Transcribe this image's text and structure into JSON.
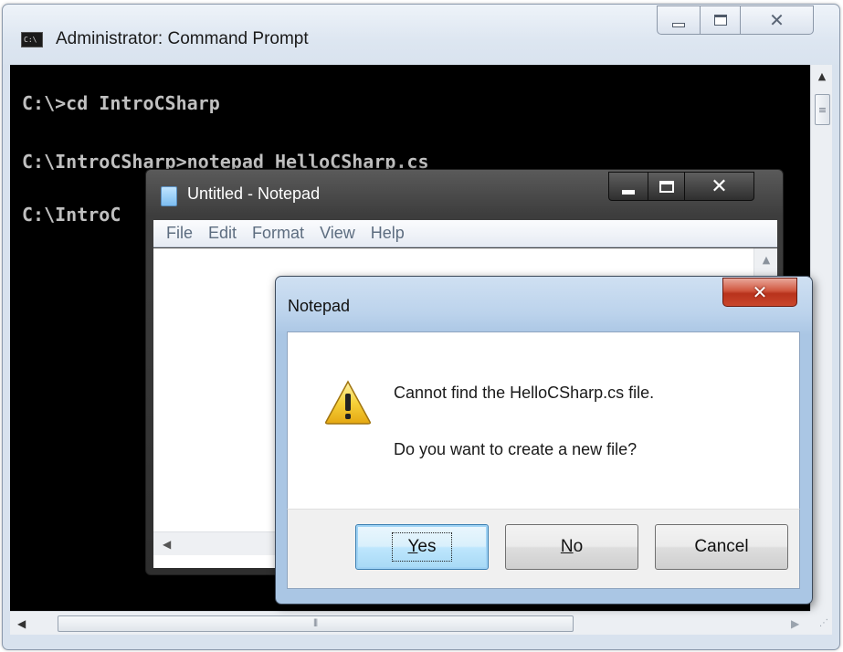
{
  "cmd_window": {
    "title": "Administrator: Command Prompt",
    "icon_text": "C:\\",
    "console_lines": [
      "C:\\>cd IntroCSharp",
      "C:\\IntroCSharp>notepad HelloCSharp.cs",
      "C:\\IntroC"
    ]
  },
  "notepad": {
    "title": "Untitled - Notepad",
    "menu": [
      "File",
      "Edit",
      "Format",
      "View",
      "Help"
    ]
  },
  "dialog": {
    "title": "Notepad",
    "message_line1": "Cannot find the HelloCSharp.cs file.",
    "message_line2": "Do you want to create a new file?",
    "buttons": {
      "yes_accel": "Y",
      "yes_rest": "es",
      "no_accel": "N",
      "no_rest": "o",
      "cancel": "Cancel"
    }
  },
  "icons": {
    "warning": "warning-icon",
    "close": "close-icon",
    "minimize": "minimize-icon",
    "maximize": "maximize-icon"
  },
  "colors": {
    "console_bg": "#000000",
    "console_text": "#c0c0c0",
    "dialog_close": "#c9462c",
    "default_button": "#bee6fd"
  }
}
